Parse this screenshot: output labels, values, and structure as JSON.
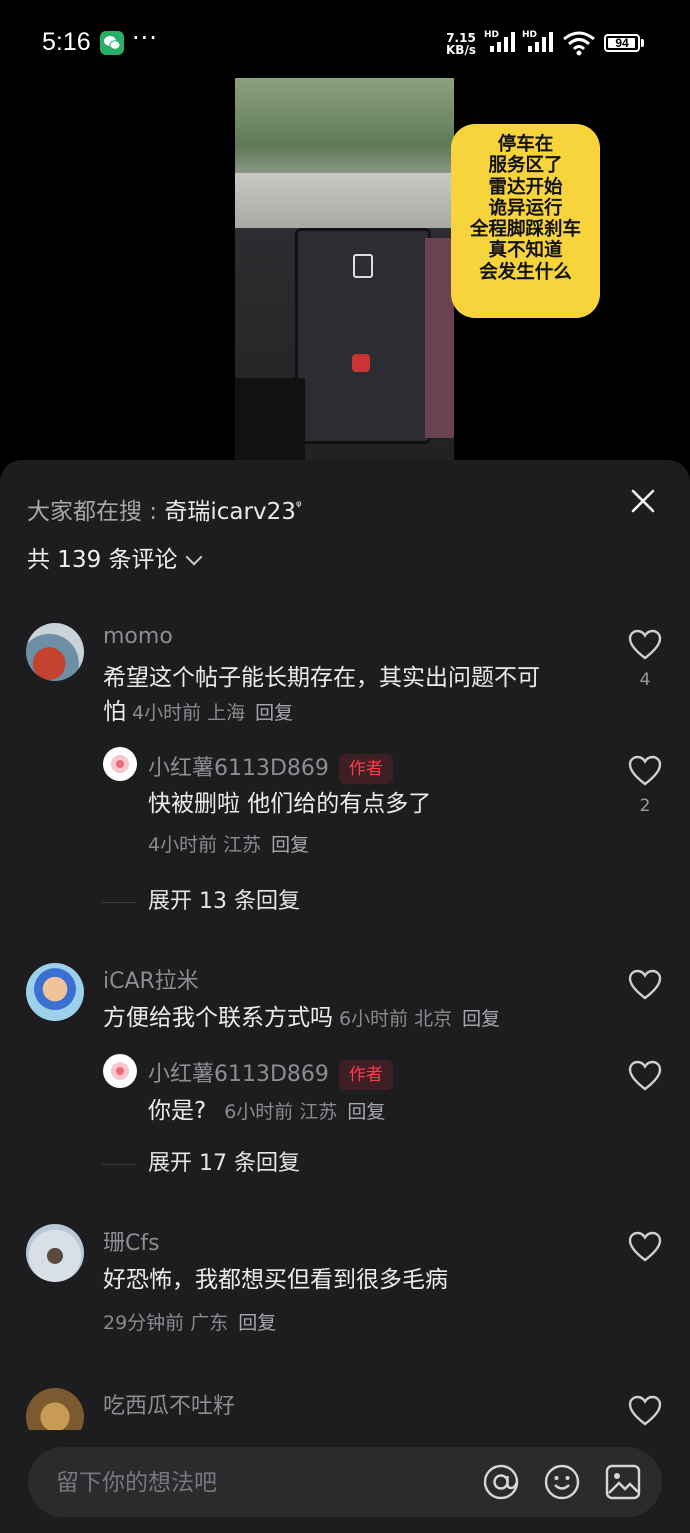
{
  "status_bar": {
    "time": "5:16",
    "dots": "···",
    "net_speed_value": "7.15",
    "net_speed_unit": "KB/s",
    "hd1": "HD",
    "hd2": "HD",
    "battery": "94"
  },
  "video": {
    "caption_lines": [
      "停车在",
      "服务区了",
      "雷达开始",
      "诡异运行",
      "全程脚踩刹车",
      "真不知道",
      "会发生什么"
    ]
  },
  "sheet": {
    "search_prefix": "大家都在搜",
    "search_sep": " : ",
    "search_keyword": "奇瑞icarv23",
    "search_icon_glyph": "ᵠ",
    "comment_count_label": "共 139 条评论",
    "comments": [
      {
        "username": "momo",
        "text_line1": "希望这个帖子能长期存在，其实出问题不可",
        "text_line2": "怕",
        "meta": "4小时前 上海",
        "reply_label": "回复",
        "likes": "4",
        "reply": {
          "username": "小红薯6113D869",
          "badge": "作者",
          "text": "快被删啦 他们给的有点多了",
          "meta": "4小时前 江苏",
          "reply_label": "回复",
          "likes": "2"
        },
        "expand_label": "展开 13 条回复"
      },
      {
        "username": "iCAR拉米",
        "text": "方便给我个联系方式吗",
        "meta": "6小时前 北京",
        "reply_label": "回复",
        "reply": {
          "username": "小红薯6113D869",
          "badge": "作者",
          "text": "你是?",
          "meta": "6小时前 江苏",
          "reply_label": "回复"
        },
        "expand_label": "展开 17 条回复"
      },
      {
        "username": "珊Cfs",
        "text": "好恐怖，我都想买但看到很多毛病",
        "meta": "29分钟前 广东",
        "reply_label": "回复"
      },
      {
        "username": "吃西瓜不吐籽"
      }
    ]
  },
  "input_bar": {
    "placeholder": "留下你的想法吧"
  },
  "colors": {
    "sheet_bg": "#1d1d1f",
    "caption_bg": "#f7d43c",
    "author_badge": "#ff3b4f"
  }
}
